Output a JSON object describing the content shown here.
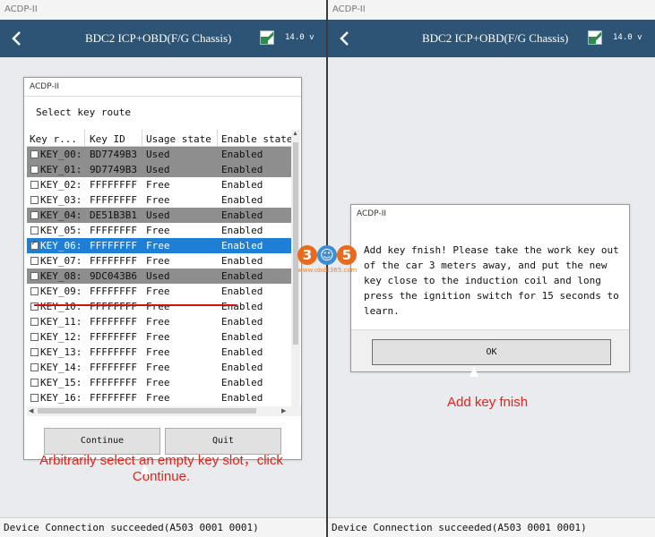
{
  "left": {
    "window_title": "ACDP-II",
    "header": {
      "title": "BDC2 ICP+OBD(F/G Chassis)",
      "version": "14.0 v"
    },
    "dialog": {
      "title": "ACDP-II",
      "prompt": "Select key route",
      "columns": [
        "Key r...",
        "Key ID",
        "Usage state",
        "Enable state"
      ],
      "rows": [
        {
          "key": "KEY_00:",
          "id": "BD7749B3",
          "usage": "Used",
          "enable": "Enabled",
          "kind": "used",
          "checked": false
        },
        {
          "key": "KEY_01:",
          "id": "9D7749B3",
          "usage": "Used",
          "enable": "Enabled",
          "kind": "used",
          "checked": false
        },
        {
          "key": "KEY_02:",
          "id": "FFFFFFFF",
          "usage": "Free",
          "enable": "Enabled",
          "kind": "free",
          "checked": false
        },
        {
          "key": "KEY_03:",
          "id": "FFFFFFFF",
          "usage": "Free",
          "enable": "Enabled",
          "kind": "free",
          "checked": false
        },
        {
          "key": "KEY_04:",
          "id": "DE51B3B1",
          "usage": "Used",
          "enable": "Enabled",
          "kind": "used",
          "checked": false
        },
        {
          "key": "KEY_05:",
          "id": "FFFFFFFF",
          "usage": "Free",
          "enable": "Enabled",
          "kind": "free",
          "checked": false
        },
        {
          "key": "KEY_06:",
          "id": "FFFFFFFF",
          "usage": "Free",
          "enable": "Enabled",
          "kind": "selected",
          "checked": true
        },
        {
          "key": "KEY_07:",
          "id": "FFFFFFFF",
          "usage": "Free",
          "enable": "Enabled",
          "kind": "free",
          "checked": false
        },
        {
          "key": "KEY_08:",
          "id": "9DC043B6",
          "usage": "Used",
          "enable": "Enabled",
          "kind": "used",
          "checked": false
        },
        {
          "key": "KEY_09:",
          "id": "FFFFFFFF",
          "usage": "Free",
          "enable": "Enabled",
          "kind": "free",
          "checked": false
        },
        {
          "key": "KEY_10:",
          "id": "FFFFFFFF",
          "usage": "Free",
          "enable": "Enabled",
          "kind": "free",
          "checked": false
        },
        {
          "key": "KEY_11:",
          "id": "FFFFFFFF",
          "usage": "Free",
          "enable": "Enabled",
          "kind": "free",
          "checked": false
        },
        {
          "key": "KEY_12:",
          "id": "FFFFFFFF",
          "usage": "Free",
          "enable": "Enabled",
          "kind": "free",
          "checked": false
        },
        {
          "key": "KEY_13:",
          "id": "FFFFFFFF",
          "usage": "Free",
          "enable": "Enabled",
          "kind": "free",
          "checked": false
        },
        {
          "key": "KEY_14:",
          "id": "FFFFFFFF",
          "usage": "Free",
          "enable": "Enabled",
          "kind": "free",
          "checked": false
        },
        {
          "key": "KEY_15:",
          "id": "FFFFFFFF",
          "usage": "Free",
          "enable": "Enabled",
          "kind": "free",
          "checked": false
        },
        {
          "key": "KEY_16:",
          "id": "FFFFFFFF",
          "usage": "Free",
          "enable": "Enabled",
          "kind": "free",
          "checked": false
        }
      ],
      "continue_label": "Continue",
      "quit_label": "Quit"
    },
    "caption_line1": "Arbitrarily select an empty key slot，click",
    "caption_line2": "Continue.",
    "status": "Device Connection succeeded(A503 0001 0001)"
  },
  "right": {
    "window_title": "ACDP-II",
    "header": {
      "title": "BDC2 ICP+OBD(F/G Chassis)",
      "version": "14.0 v"
    },
    "dialog": {
      "title": "ACDP-II",
      "message": "Add key fnish! Please take the work key out of the car 3 meters away, and put the new key close to the induction coil and long press the ignition switch for 15 seconds to learn.",
      "ok_label": "OK"
    },
    "caption": "Add key fnish",
    "status": "Device Connection succeeded(A503 0001 0001)"
  },
  "watermark": {
    "digit_left": "3",
    "digit_right": "5",
    "url": "www.obdii365.com"
  },
  "colors": {
    "header_bg": "#2d5474",
    "used_row": "#8e8e8e",
    "selected_row": "#1e7fd6",
    "caption_red": "#e0241a"
  },
  "icons": {
    "back": "chevron-left-icon",
    "app": "flag-icon",
    "checkbox": "checkbox-icon"
  }
}
